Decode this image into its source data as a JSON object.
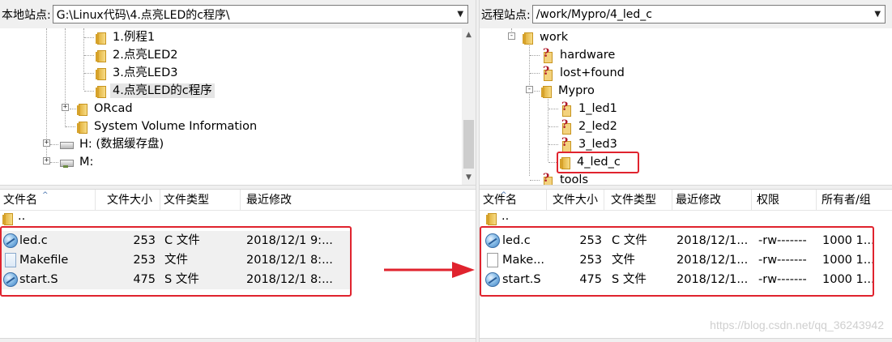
{
  "local": {
    "site_label": "本地站点:",
    "path": "G:\\Linux代码\\4.点亮LED的c程序\\",
    "tree": [
      {
        "label": "1.例程1",
        "type": "folder"
      },
      {
        "label": "2.点亮LED2",
        "type": "folder"
      },
      {
        "label": "3.点亮LED3",
        "type": "folder"
      },
      {
        "label": "4.点亮LED的c程序",
        "type": "folder",
        "selected": true
      },
      {
        "label": "ORcad",
        "type": "folder",
        "expander": "+"
      },
      {
        "label": "System Volume Information",
        "type": "folder"
      },
      {
        "label": "H: (数据缓存盘)",
        "type": "drive",
        "expander": "+"
      },
      {
        "label": "M:",
        "type": "netdrive",
        "expander": "+"
      }
    ],
    "columns": [
      "文件名",
      "文件大小",
      "文件类型",
      "最近修改"
    ],
    "parent_entry": "..",
    "files": [
      {
        "name": "led.c",
        "size": "253",
        "type": "C 文件",
        "modified": "2018/12/1 9:...",
        "icon": "c-file-icon"
      },
      {
        "name": "Makefile",
        "size": "253",
        "type": "文件",
        "modified": "2018/12/1 8:...",
        "icon": "document-icon"
      },
      {
        "name": "start.S",
        "size": "475",
        "type": "S 文件",
        "modified": "2018/12/1 8:...",
        "icon": "c-file-icon"
      }
    ]
  },
  "remote": {
    "site_label": "远程站点:",
    "path": "/work/Mypro/4_led_c",
    "tree": [
      {
        "label": "work",
        "type": "folder",
        "expander": "-"
      },
      {
        "label": "hardware",
        "type": "unknown"
      },
      {
        "label": "lost+found",
        "type": "unknown"
      },
      {
        "label": "Mypro",
        "type": "folder",
        "expander": "-"
      },
      {
        "label": "1_led1",
        "type": "unknown"
      },
      {
        "label": "2_led2",
        "type": "unknown"
      },
      {
        "label": "3_led3",
        "type": "unknown"
      },
      {
        "label": "4_led_c",
        "type": "folder",
        "highlighted": true
      },
      {
        "label": "tools",
        "type": "unknown"
      }
    ],
    "columns": [
      "文件名",
      "文件大小",
      "文件类型",
      "最近修改",
      "权限",
      "所有者/组"
    ],
    "parent_entry": "..",
    "files": [
      {
        "name": "led.c",
        "size": "253",
        "type": "C 文件",
        "modified": "2018/12/1...",
        "perm": "-rw-------",
        "owner": "1000 1...",
        "icon": "c-file-icon"
      },
      {
        "name": "Make...",
        "size": "253",
        "type": "文件",
        "modified": "2018/12/1...",
        "perm": "-rw-------",
        "owner": "1000 1...",
        "icon": "document-icon"
      },
      {
        "name": "start.S",
        "size": "475",
        "type": "S 文件",
        "modified": "2018/12/1...",
        "perm": "-rw-------",
        "owner": "1000 1...",
        "icon": "c-file-icon"
      }
    ]
  },
  "watermark": "https://blog.csdn.net/qq_36243942",
  "colors": {
    "highlight": "#e0232e",
    "selection": "#e5e5e5",
    "chrome": "#f0f0f0"
  }
}
